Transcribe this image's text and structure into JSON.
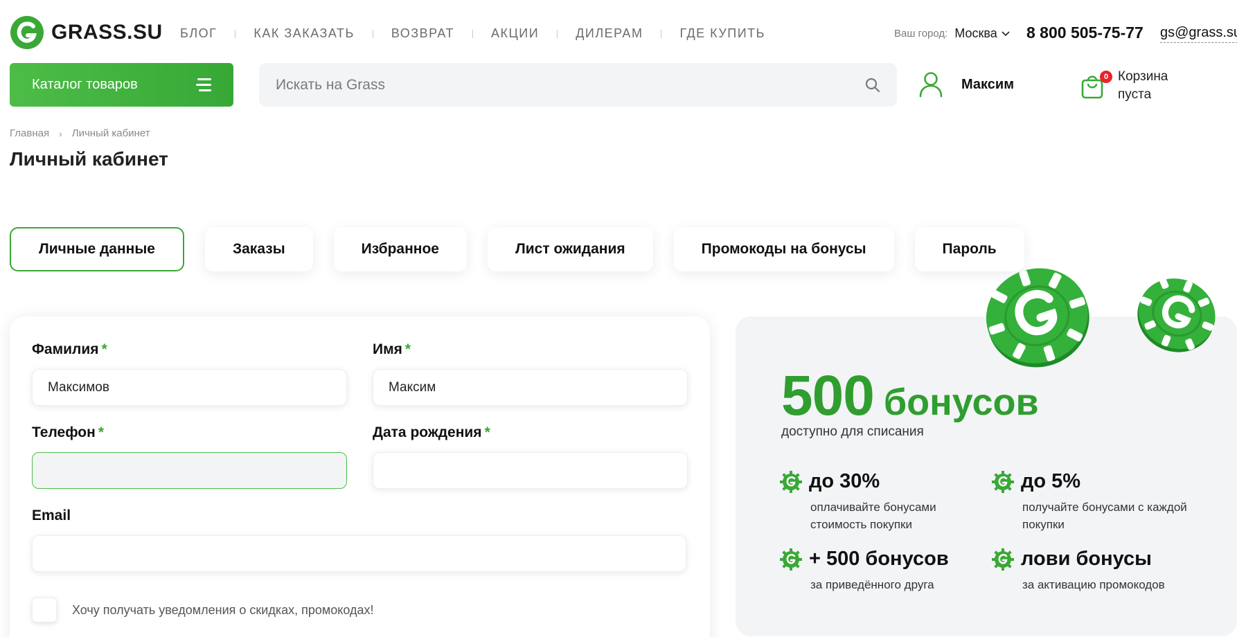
{
  "brand": {
    "name": "GRASS.SU",
    "accent": "#3aa837",
    "accent_light": "#4cbd47"
  },
  "topnav": [
    "БЛОГ",
    "КАК ЗАКАЗАТЬ",
    "ВОЗВРАТ",
    "АКЦИИ",
    "ДИЛЕРАМ",
    "ГДЕ КУПИТЬ"
  ],
  "header": {
    "city_label": "Ваш город:",
    "city_value": "Москва",
    "phone": "8 800 505-75-77",
    "email": "gs@grass.su",
    "catalog_label": "Каталог товаров",
    "search_placeholder": "Искать на Grass",
    "user_name": "Максим",
    "cart_count": "0",
    "cart_text": "Корзина пуста"
  },
  "breadcrumb": [
    "Главная",
    "Личный кабинет"
  ],
  "page_title": "Личный кабинет",
  "tabs": [
    "Личные данные",
    "Заказы",
    "Избранное",
    "Лист ожидания",
    "Промокоды на бонусы",
    "Пароль"
  ],
  "form": {
    "lastname_label": "Фамилия",
    "lastname_value": "Максимов",
    "firstname_label": "Имя",
    "firstname_value": "Максим",
    "phone_label": "Телефон",
    "phone_value": "",
    "birthdate_label": "Дата рождения",
    "birthdate_value": "",
    "email_label": "Email",
    "email_value": "",
    "required_mark": "*",
    "consent_text": "Хочу получать уведомления о скидках, промокодах!"
  },
  "bonus": {
    "amount": "500",
    "word": "бонусов",
    "subtitle": "доступно для списания",
    "perks": [
      {
        "title": "до 30%",
        "desc": "оплачивайте бонусами стоимость покупки"
      },
      {
        "title": "до 5%",
        "desc": "получайте бонусами с каждой покупки"
      },
      {
        "title": "+ 500 бонусов",
        "desc": "за приведённого друга"
      },
      {
        "title": "лови бонусы",
        "desc": "за активацию промокодов"
      }
    ]
  },
  "icons": [
    "logo-g-icon",
    "chevron-down-icon",
    "menu-icon",
    "search-icon",
    "user-icon",
    "cart-icon",
    "gear-g-icon",
    "bonus-chip-icon"
  ]
}
